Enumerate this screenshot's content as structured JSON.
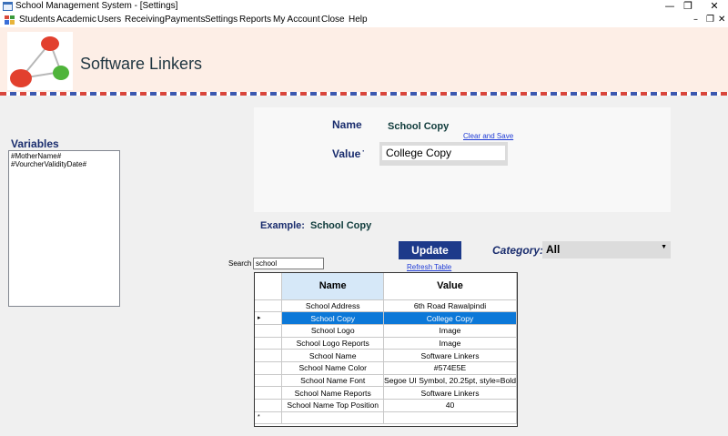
{
  "window": {
    "title": "School Management System - [Settings]",
    "minimize_glyph": "—",
    "restore_glyph": "❐",
    "close_glyph": "✕"
  },
  "menu": {
    "items": [
      "Students",
      "Academic",
      "Users",
      "Receiving",
      "Payments",
      "Settings",
      "Reports",
      "My Account",
      "Close",
      "Help"
    ],
    "mdi_minimize": "–",
    "mdi_restore": "❐",
    "mdi_close": "✕"
  },
  "header": {
    "brand": "Software Linkers"
  },
  "variables": {
    "title": "Variables",
    "items": [
      "#MotherName#",
      "#VourcherValidityDate#"
    ]
  },
  "editor": {
    "name_label": "Name",
    "name_value": "School Copy",
    "clear_save_label": "Clear and Save",
    "value_label": "Value",
    "value_marker": "·",
    "value_text": "College Copy",
    "example_label": "Example:",
    "example_value": "School Copy"
  },
  "toolbar": {
    "update_label": "Update",
    "refresh_label": "Refresh Table",
    "category_label": "Category:",
    "category_value": "All",
    "search_label": "Search",
    "search_value": "school"
  },
  "table": {
    "columns": [
      "Name",
      "Value"
    ],
    "rows": [
      {
        "name": "School Address",
        "value": "6th Road Rawalpindi"
      },
      {
        "name": "School Copy",
        "value": "College Copy"
      },
      {
        "name": "School Logo",
        "value": "Image"
      },
      {
        "name": "School Logo Reports",
        "value": "Image"
      },
      {
        "name": "School Name",
        "value": "Software Linkers"
      },
      {
        "name": "School Name Color",
        "value": "#574E5E"
      },
      {
        "name": "School Name Font",
        "value": "Segoe UI Symbol, 20.25pt, style=Bold"
      },
      {
        "name": "School Name Reports",
        "value": "Software Linkers"
      },
      {
        "name": "School Name Top Position",
        "value": "40"
      }
    ],
    "selected_row_index": 1,
    "selected_marker": "▸",
    "new_row_marker": "*"
  },
  "colors": {
    "accent": "#1d3a8a",
    "label_blue": "#1a2d6e",
    "selection": "#0c78d8",
    "header_bg": "#fdeee6",
    "column_highlight": "#d6e8f8"
  }
}
